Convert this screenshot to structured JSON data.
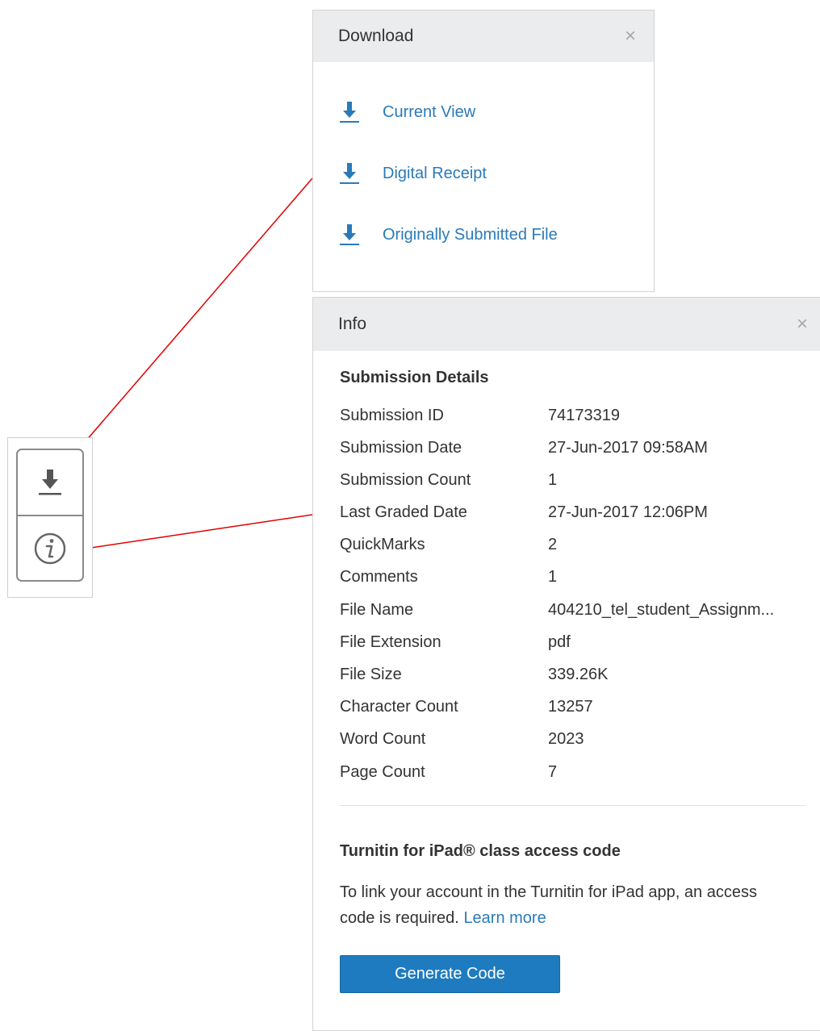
{
  "download_panel": {
    "title": "Download",
    "close": "×",
    "items": [
      {
        "label": "Current View"
      },
      {
        "label": "Digital Receipt"
      },
      {
        "label": "Originally Submitted File"
      }
    ]
  },
  "info_panel": {
    "title": "Info",
    "close": "×",
    "section_title": "Submission Details",
    "details": [
      {
        "key": "Submission ID",
        "value": "74173319"
      },
      {
        "key": "Submission Date",
        "value": "27-Jun-2017 09:58AM"
      },
      {
        "key": "Submission Count",
        "value": "1"
      },
      {
        "key": "Last Graded Date",
        "value": "27-Jun-2017 12:06PM"
      },
      {
        "key": "QuickMarks",
        "value": "2"
      },
      {
        "key": "Comments",
        "value": "1"
      },
      {
        "key": "File Name",
        "value": "404210_tel_student_Assignm..."
      },
      {
        "key": "File Extension",
        "value": "pdf"
      },
      {
        "key": "File Size",
        "value": "339.26K"
      },
      {
        "key": "Character Count",
        "value": "13257"
      },
      {
        "key": "Word Count",
        "value": "2023"
      },
      {
        "key": "Page Count",
        "value": "7"
      }
    ],
    "ipad": {
      "title": "Turnitin for iPad® class access code",
      "text": "To link your account in the Turnitin for iPad app, an access code is required.",
      "learn_more": "Learn more",
      "button": "Generate Code"
    }
  },
  "toolbar": {
    "buttons": [
      {
        "icon": "download-icon"
      },
      {
        "icon": "info-icon"
      }
    ]
  },
  "colors": {
    "link": "#2a7ab8",
    "header_bg": "#eaecee",
    "button_bg": "#1f7bbf",
    "annotation_arrow": "#e00000"
  }
}
